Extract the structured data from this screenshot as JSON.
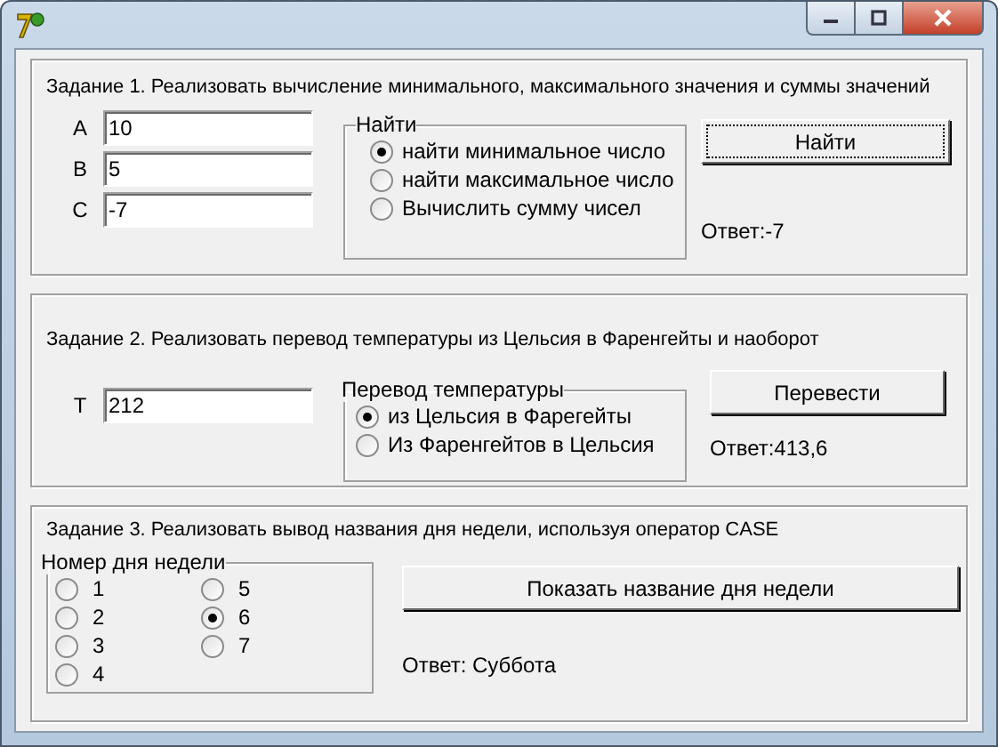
{
  "task1": {
    "heading": "Задание 1. Реализовать вычисление минимального, максимального значения и  суммы значений",
    "fields": [
      {
        "label": "A",
        "value": "10"
      },
      {
        "label": "B",
        "value": "5"
      },
      {
        "label": "C",
        "value": "-7"
      }
    ],
    "group": {
      "title": "Найти",
      "options": [
        {
          "label": "найти минимальное число",
          "selected": true
        },
        {
          "label": "найти максимальное число",
          "selected": false
        },
        {
          "label": "Вычислить сумму чисел",
          "selected": false
        }
      ]
    },
    "button": {
      "label": "Найти",
      "focused": true
    },
    "answer": "Ответ:-7"
  },
  "task2": {
    "heading": "Задание 2. Реализовать перевод температуры из Цельсия в Фаренгейты и наоборот",
    "fields": [
      {
        "label": "T",
        "value": "212"
      }
    ],
    "group": {
      "title": "Перевод температуры",
      "options": [
        {
          "label": "из Цельсия в Фарегейты",
          "selected": true
        },
        {
          "label": "Из Фаренгейтов в Цельсия",
          "selected": false
        }
      ]
    },
    "button": {
      "label": "Перевести",
      "focused": false
    },
    "answer": "Ответ:413,6"
  },
  "task3": {
    "heading": "Задание 3. Реализовать вывод названия дня недели, используя оператор CASE",
    "group": {
      "title": "Номер дня недели",
      "options": [
        {
          "label": "1",
          "selected": false
        },
        {
          "label": "2",
          "selected": false
        },
        {
          "label": "3",
          "selected": false
        },
        {
          "label": "4",
          "selected": false
        },
        {
          "label": "5",
          "selected": false
        },
        {
          "label": "6",
          "selected": true
        },
        {
          "label": "7",
          "selected": false
        }
      ]
    },
    "button": {
      "label": "Показать название дня недели",
      "focused": false
    },
    "answer": "Ответ: Суббота"
  }
}
